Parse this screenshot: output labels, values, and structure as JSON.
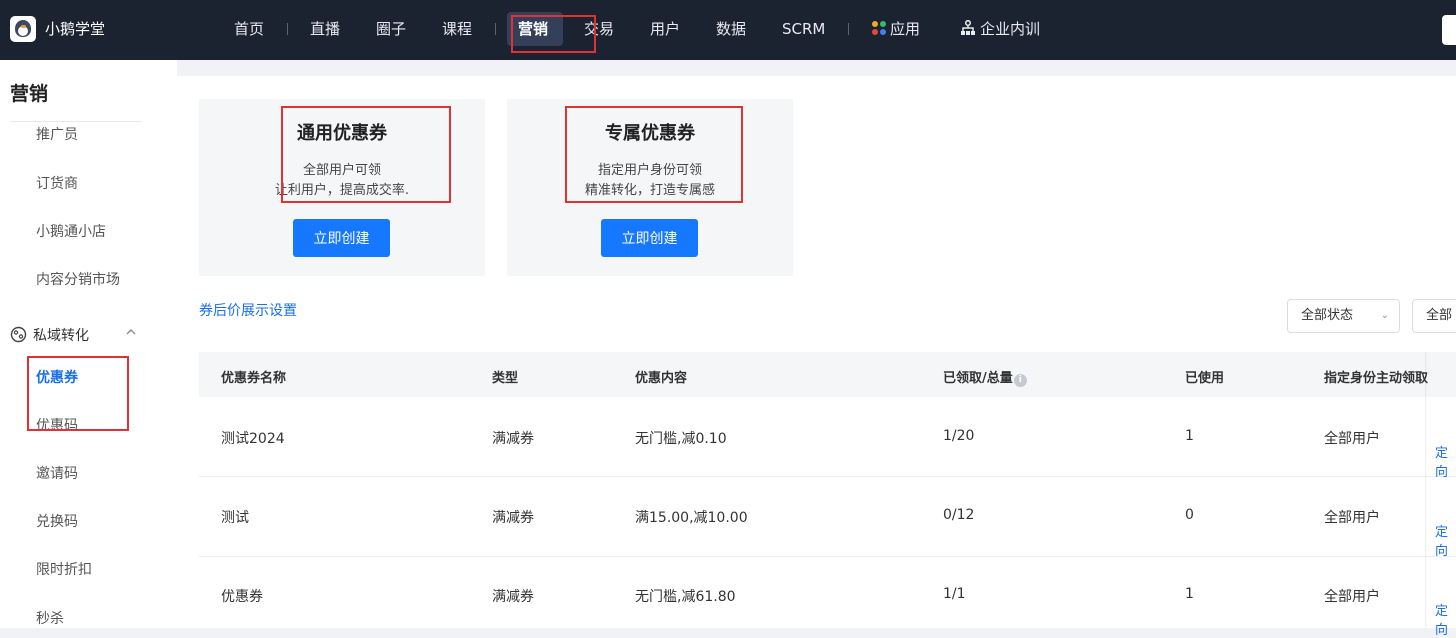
{
  "app": {
    "brand": "小鹅学堂"
  },
  "topnav": {
    "items": [
      "首页",
      "直播",
      "圈子",
      "课程",
      "营销",
      "交易",
      "用户",
      "数据",
      "SCRM",
      "应用",
      "企业内训"
    ],
    "active": "营销"
  },
  "sidebar": {
    "title": "营销",
    "items_top": [
      "推广员",
      "订货商",
      "小鹅通小店",
      "内容分销市场"
    ],
    "group": "私域转化",
    "items_group": [
      "优惠券",
      "优惠码",
      "邀请码",
      "兑换码",
      "限时折扣",
      "秒杀"
    ],
    "active": "优惠券"
  },
  "cards": [
    {
      "title": "通用优惠券",
      "desc1": "全部用户可领",
      "desc2": "让利用户，提高成交率.",
      "button": "立即创建"
    },
    {
      "title": "专属优惠券",
      "desc1": "指定用户身份可领",
      "desc2": "精准转化，打造专属感",
      "button": "立即创建"
    }
  ],
  "link_setting": "券后价展示设置",
  "filters": {
    "status": "全部状态",
    "second": "全部"
  },
  "table": {
    "columns": [
      "优惠券名称",
      "类型",
      "优惠内容",
      "已领取/总量",
      "已使用",
      "指定身份主动领取"
    ],
    "rows": [
      [
        "测试2024",
        "满减券",
        "无门槛,减0.10",
        "1/20",
        "1",
        "全部用户"
      ],
      [
        "测试",
        "满减券",
        "满15.00,减10.00",
        "0/12",
        "0",
        "全部用户"
      ],
      [
        "优惠券",
        "满减券",
        "无门槛,减61.80",
        "1/1",
        "1",
        "全部用户"
      ]
    ],
    "row_action": "定向"
  },
  "colors": {
    "topbar": "#1b2230",
    "accent": "#1677ff",
    "highlight": "#e03232"
  }
}
